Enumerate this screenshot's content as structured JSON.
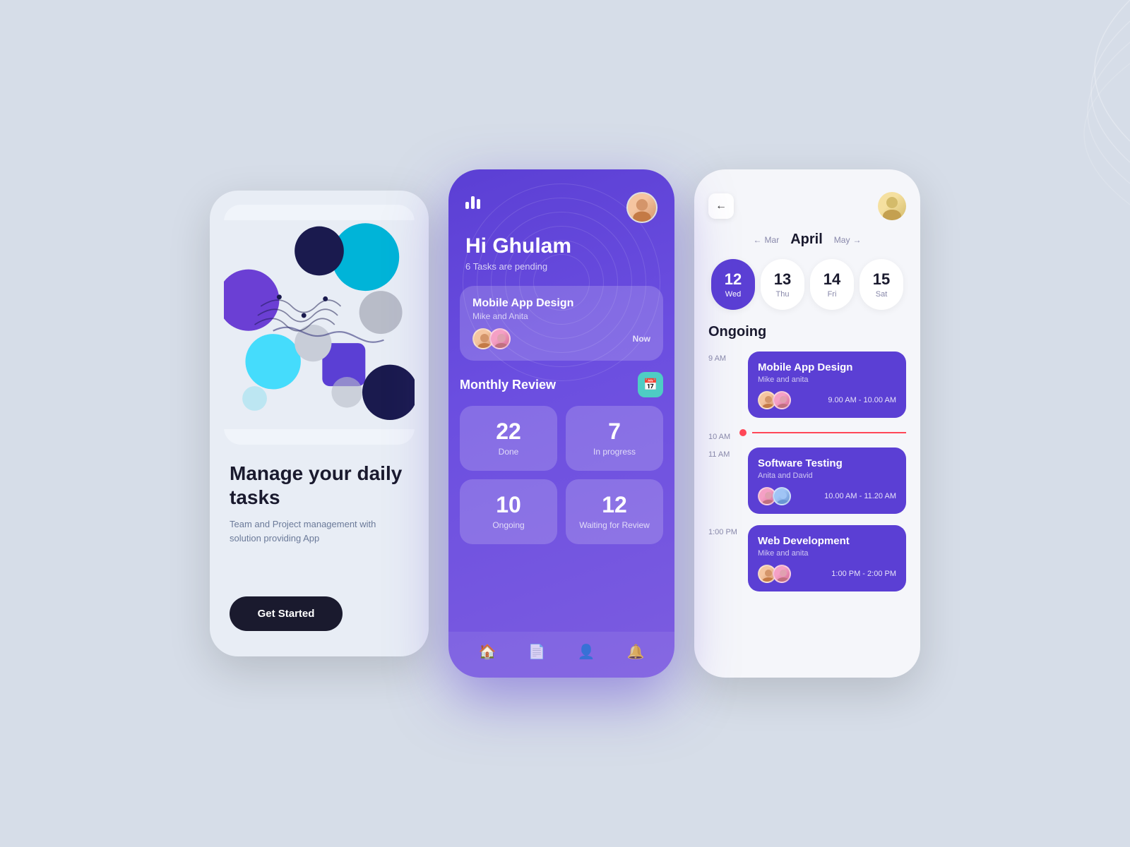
{
  "background": "#d6dde8",
  "phone1": {
    "title": "Manage your daily tasks",
    "subtitle": "Team and Project management with solution providing App",
    "cta": "Get Started"
  },
  "phone2": {
    "greeting": "Hi Ghulam",
    "tasks_pending": "6 Tasks are pending",
    "task_title": "Mobile App Design",
    "task_sub": "Mike and Anita",
    "task_time": "Now",
    "review_section": "Monthly Review",
    "stats": [
      {
        "number": "22",
        "label": "Done"
      },
      {
        "number": "7",
        "label": "In progress"
      },
      {
        "number": "10",
        "label": "Ongoing"
      },
      {
        "number": "12",
        "label": "Waiting for Review"
      }
    ],
    "nav_items": [
      "home",
      "document",
      "profile",
      "bell"
    ]
  },
  "phone3": {
    "prev_month": "Mar",
    "current_month": "April",
    "next_month": "May",
    "dates": [
      {
        "num": "12",
        "day": "Wed",
        "active": true
      },
      {
        "num": "13",
        "day": "Thu",
        "active": false
      },
      {
        "num": "14",
        "day": "Fri",
        "active": false
      },
      {
        "num": "15",
        "day": "Sat",
        "active": false
      }
    ],
    "section_title": "Ongoing",
    "events": [
      {
        "time_label": "9 AM",
        "title": "Mobile App Design",
        "sub": "Mike and anita",
        "time_range": "9.00 AM - 10.00 AM"
      },
      {
        "time_label": "10 AM",
        "is_current": true
      },
      {
        "time_label": "11 AM",
        "title": "Software Testing",
        "sub": "Anita and David",
        "time_range": "10.00 AM - 11.20 AM"
      },
      {
        "time_label": "1:00 PM",
        "title": "Web Development",
        "sub": "Mike and anita",
        "time_range": "1:00 PM - 2:00 PM"
      }
    ]
  }
}
